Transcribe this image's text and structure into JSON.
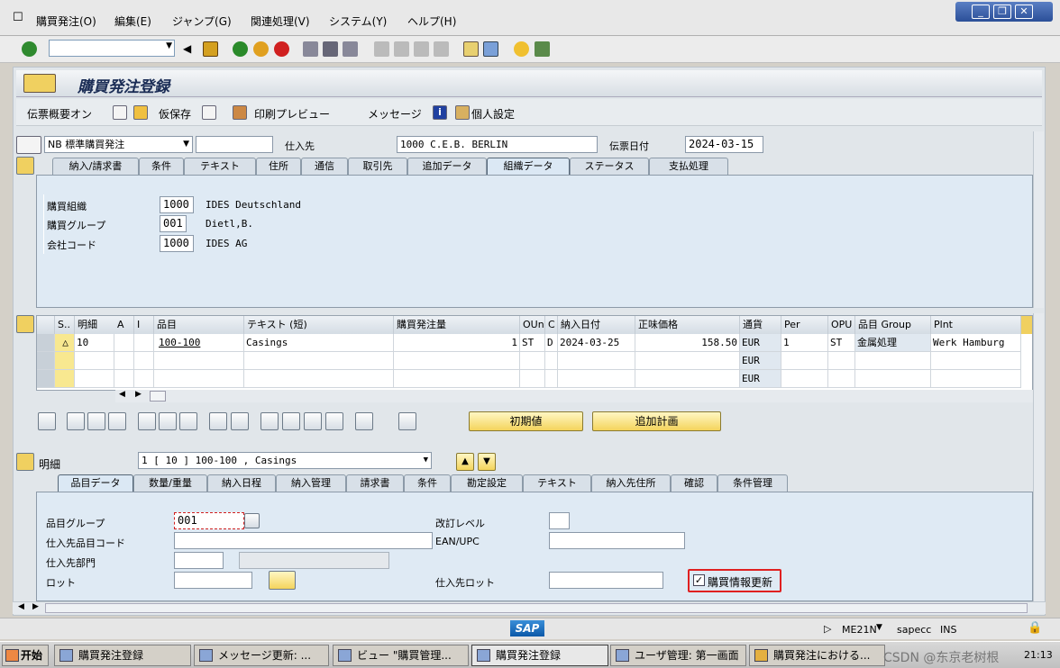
{
  "menu": {
    "items": [
      "購買発注(O)",
      "編集(E)",
      "ジャンプ(G)",
      "関連処理(V)",
      "システム(Y)",
      "ヘルプ(H)"
    ]
  },
  "window_controls": {
    "minimize": "_",
    "restore": "❐",
    "close": "✕"
  },
  "page": {
    "title": "購買発注登録"
  },
  "app_toolbar": {
    "doc_overview": "伝票概要オン",
    "hold": "仮保存",
    "print_preview": "印刷プレビュー",
    "messages": "メッセージ",
    "personal_settings": "個人設定"
  },
  "header": {
    "doc_type": "NB 標準購買発注",
    "doc_number": "",
    "vendor_label": "仕入先",
    "vendor_value": "1000 C.E.B. BERLIN",
    "doc_date_label": "伝票日付",
    "doc_date_value": "2024-03-15"
  },
  "header_tabs": [
    "納入/請求書",
    "条件",
    "テキスト",
    "住所",
    "通信",
    "取引先",
    "追加データ",
    "組織データ",
    "ステータス",
    "支払処理"
  ],
  "org_data": {
    "purch_org_label": "購買組織",
    "purch_org_value": "1000",
    "purch_org_desc": "IDES Deutschland",
    "purch_group_label": "購買グループ",
    "purch_group_value": "001",
    "purch_group_desc": "Dietl,B.",
    "company_label": "会社コード",
    "company_value": "1000",
    "company_desc": "IDES AG"
  },
  "items_table": {
    "headers": [
      "S..",
      "明細",
      "A",
      "I",
      "品目",
      "テキスト (短)",
      "購買発注量",
      "OUn",
      "C",
      "納入日付",
      "正味価格",
      "通貨",
      "Per",
      "OPU",
      "品目 Group",
      "Plnt"
    ],
    "rows": [
      {
        "item": "10",
        "material": "100-100",
        "text": "Casings",
        "qty": "1",
        "oun": "ST",
        "c": "D",
        "date": "2024-03-25",
        "price": "158.50",
        "currency": "EUR",
        "per": "1",
        "opu": "ST",
        "matgroup": "金属処理",
        "plant": "Werk Hamburg"
      },
      {
        "item": "",
        "material": "",
        "text": "",
        "qty": "",
        "oun": "",
        "c": "",
        "date": "",
        "price": "",
        "currency": "EUR",
        "per": "",
        "opu": "",
        "matgroup": "",
        "plant": ""
      },
      {
        "item": "",
        "material": "",
        "text": "",
        "qty": "",
        "oun": "",
        "c": "",
        "date": "",
        "price": "",
        "currency": "EUR",
        "per": "",
        "opu": "",
        "matgroup": "",
        "plant": ""
      }
    ]
  },
  "item_buttons": {
    "default_values": "初期値",
    "add_planning": "追加計画"
  },
  "item_detail": {
    "label": "明細",
    "selector_value": "1 [ 10 ] 100-100 , Casings"
  },
  "item_tabs": [
    "品目データ",
    "数量/重量",
    "納入日程",
    "納入管理",
    "請求書",
    "条件",
    "勘定設定",
    "テキスト",
    "納入先住所",
    "確認",
    "条件管理"
  ],
  "material_data": {
    "mat_group_label": "品目グループ",
    "mat_group_value": "001",
    "vendor_mat_label": "仕入先品目コード",
    "vendor_mat_value": "",
    "vendor_subrange_label": "仕入先部門",
    "vendor_subrange_value": "",
    "batch_label": "ロット",
    "batch_value": "",
    "revision_label": "改訂レベル",
    "revision_value": "",
    "ean_label": "EAN/UPC",
    "ean_value": "",
    "vendor_batch_label": "仕入先ロット",
    "vendor_batch_value": "",
    "info_update_label": "購買情報更新",
    "info_update_checked": true
  },
  "status_bar": {
    "tcode": "ME21N",
    "server": "sapecc",
    "mode": "INS"
  },
  "taskbar": {
    "start": "开始",
    "tasks": [
      "購買発注登録",
      "メッセージ更新: ...",
      "ビュー \"購買管理...",
      "購買発注登録",
      "ユーザ管理: 第一画面",
      "購買発注における..."
    ],
    "clock": "21:13"
  },
  "watermark": "CSDN @东京老树根",
  "colors": {
    "accent": "#1a2c55",
    "highlight": "#e02020"
  }
}
